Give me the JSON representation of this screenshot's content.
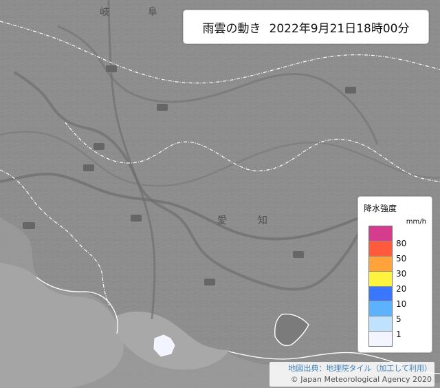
{
  "map": {
    "place_labels": {
      "gifu_left": "岐",
      "gifu_right": "阜",
      "aichi_left": "愛",
      "aichi_right": "知"
    },
    "highlight_color": "#f2f5ff",
    "map_background_color": "#8d8d8d"
  },
  "title": {
    "event": "雨雲の動き",
    "datetime": "2022年9月21日18時00分"
  },
  "legend": {
    "title": "降水強度",
    "unit": "mm/h",
    "items": [
      {
        "label": "80",
        "color": "#d63c8d"
      },
      {
        "label": "50",
        "color": "#ff5a3b"
      },
      {
        "label": "30",
        "color": "#ffa33a"
      },
      {
        "label": "20",
        "color": "#fff33d"
      },
      {
        "label": "10",
        "color": "#3a77ff"
      },
      {
        "label": "5",
        "color": "#5db2ff"
      },
      {
        "label": "1",
        "color": "#bfe3ff"
      },
      {
        "label": "",
        "color": "#f2f5ff"
      }
    ]
  },
  "attribution": {
    "source": "地図出典：地理院タイル（加工して利用）",
    "copyright": "© Japan Meteorological Agency 2020"
  }
}
